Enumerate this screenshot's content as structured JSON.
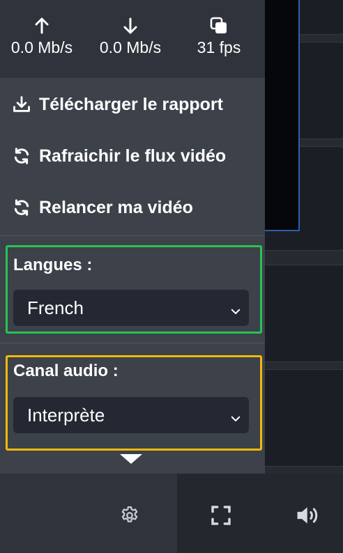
{
  "stats": {
    "upload": {
      "icon": "arrow-up-icon",
      "value": "0.0 Mb/s"
    },
    "download": {
      "icon": "arrow-down-icon",
      "value": "0.0 Mb/s"
    },
    "framerate": {
      "icon": "copy-icon",
      "value": "31 fps"
    }
  },
  "menu": {
    "download_report": {
      "icon": "download-icon",
      "label": "Télécharger le rapport"
    },
    "refresh_stream": {
      "icon": "refresh-icon",
      "label": "Rafraichir le flux vidéo"
    },
    "restart_video": {
      "icon": "refresh-icon",
      "label": "Relancer ma vidéo"
    }
  },
  "language": {
    "label": "Langues :",
    "selected": "French",
    "highlight_color": "#27c452"
  },
  "audio_channel": {
    "label": "Canal audio :",
    "selected": "Interprète",
    "highlight_color": "#f2b90a"
  },
  "controls": {
    "settings": {
      "icon": "gear-icon"
    },
    "fullscreen": {
      "icon": "fullscreen-icon"
    },
    "volume": {
      "icon": "volume-icon"
    }
  },
  "colors": {
    "panel_bg": "#3c414a",
    "stats_bg": "#2f333b",
    "select_bg": "#232833",
    "video_border": "#2c5fae"
  }
}
